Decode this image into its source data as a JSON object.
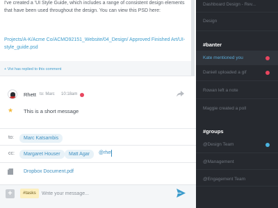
{
  "conversation": {
    "description": "I've created a 'UI Style Guide, which includes a range of consistent design elements that have been used throughout the design. You can view this PSD here:",
    "psd_link": "Projects/A-K/Acme Co/ACMO92151_Website/04_Design/ Approved Finished Art/UI-style_guide.psd",
    "replied": "+ Vivi has replied to this comment"
  },
  "message": {
    "author": "Rhett",
    "to": "to: Marc",
    "time": "10:18am",
    "text": "This is a short message",
    "status_color": "#e8465f"
  },
  "fields": {
    "to_label": "to:",
    "to_chips": [
      "Marc Katsambis"
    ],
    "cc_label": "cc:",
    "cc_chips": [
      "Margaret Houser",
      "Matt Agar"
    ],
    "cc_typing": "@rhet",
    "attachment": "Dropbox Document.pdf"
  },
  "composer": {
    "tag": "#tasks",
    "placeholder": "Write your message..."
  },
  "sidebar": {
    "items_top": [
      "Dashboard Design - Rev...",
      "Design"
    ],
    "banter_header": "#banter",
    "banter": [
      {
        "label": "Kate mentioned you",
        "dot": "#e8465f"
      },
      {
        "label": "Daniell uploaded a gif",
        "dot": "#e8465f"
      },
      {
        "label": "Rowan left a note"
      },
      {
        "label": "Maggie created a poll"
      }
    ],
    "groups_header": "#groups",
    "groups": [
      {
        "label": "@Design Team",
        "dot": "#4bb3e0"
      },
      {
        "label": "@Management"
      },
      {
        "label": "@Engagement Team"
      }
    ]
  },
  "colors": {
    "accent": "#3d9ccc",
    "sidebar_bg": "#26292f",
    "alert": "#e8465f",
    "tag_bg": "#fcefbf"
  }
}
